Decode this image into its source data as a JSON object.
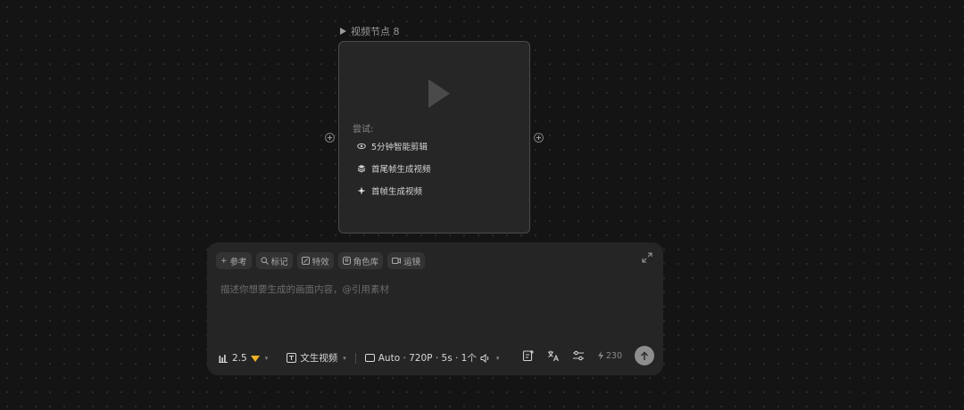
{
  "node": {
    "title": "视频节点 8",
    "try_label": "尝试:",
    "suggestions": [
      {
        "label": "5分钟智能剪辑",
        "icon": "eye-icon"
      },
      {
        "label": "首尾帧生成视频",
        "icon": "layers-icon"
      },
      {
        "label": "首帧生成视频",
        "icon": "sparkle-icon"
      }
    ]
  },
  "panel": {
    "chips": [
      {
        "label": "参考",
        "icon": "plus-icon"
      },
      {
        "label": "标记",
        "icon": "search-icon"
      },
      {
        "label": "特效",
        "icon": "effects-icon"
      },
      {
        "label": "角色库",
        "icon": "character-icon"
      },
      {
        "label": "运镜",
        "icon": "camera-icon"
      }
    ],
    "placeholder": "描述你想要生成的画面内容，@引用素材",
    "model": {
      "version": "2.5"
    },
    "mode": {
      "label": "文生视频"
    },
    "settings": {
      "label": "Auto · 720P · 5s · 1个"
    },
    "credits": "230"
  },
  "colors": {
    "background": "#141414",
    "card": "#262626",
    "panel": "#252525",
    "gem": "#f2b227",
    "send": "#8e8e8e"
  }
}
